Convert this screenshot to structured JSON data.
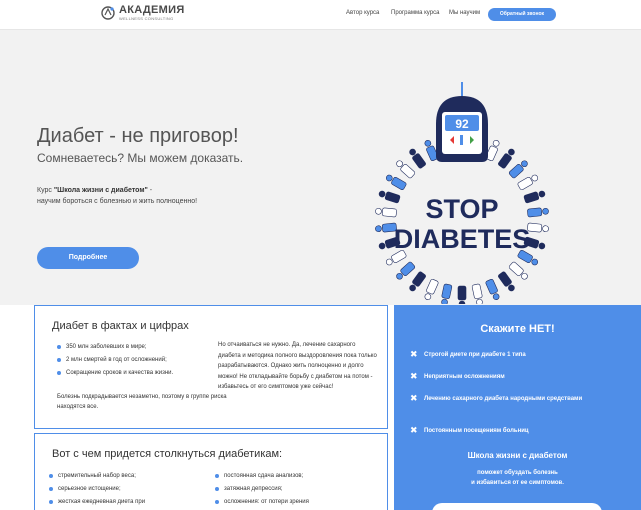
{
  "header": {
    "logo_main": "АКАДЕМИЯ",
    "logo_sub": "WELLNESS CONSULTING",
    "nav": [
      "Автор курса",
      "Программа курса",
      "Мы научим"
    ],
    "callback_label": "Обратный звонок"
  },
  "hero": {
    "title": "Диабет - не приговор!",
    "subtitle": "Сомневаетесь? Мы можем доказать.",
    "course_prefix": "Курс ",
    "course_name": "\"Школа жизни с диабетом\"",
    "course_suffix": " -",
    "course_line2": "научим бороться с болезнью и жить полноценно!",
    "more_label": "Подробнее",
    "badge": {
      "meter_value": "92",
      "line1": "STOP",
      "line2": "DIABETES"
    }
  },
  "facts": {
    "title": "Диабет в фактах и цифрах",
    "items": [
      "350 млн заболевших в мире;",
      "2 млн смертей в год от осложнений;",
      "Сокращение сроков и качества жизни."
    ],
    "note": "Болезнь подкрадывается незаметно, поэтому в группе риска находятся все.",
    "right_text": "Но отчаиваться не нужно. Да, лечение сахарного диабета и методика полного выздоровления пока только разрабатываются. Однако жить полноценно и долго можно! Не откладывайте борьбу с диабетом на потом - избавьтесь от его симптомов уже сейчас!"
  },
  "difficulties": {
    "title": "Вот с чем придется столкнуться диабетикам:",
    "left": [
      "стремительный набор веса;",
      "серьезное истощение;",
      "жесткая ежедневная диета при"
    ],
    "right": [
      "постоянная сдача анализов;",
      "затяжная депрессия;",
      "осложнения: от потери зрения"
    ]
  },
  "say_no": {
    "title": "Скажите НЕТ!",
    "items": [
      "Строгой диете при диабете 1 типа",
      "Неприятным осложнениям",
      "Лечению сахарного диабета народными средствами",
      "Постоянным посещениям больниц"
    ],
    "school_title": "Школа жизни с диабетом",
    "school_sub1": "поможет обуздать болезнь",
    "school_sub2": "и избавиться от ее симптомов."
  },
  "colors": {
    "accent": "#4f8ee8",
    "navy": "#1f2b5c",
    "hero_bg": "#f2f2f2"
  }
}
